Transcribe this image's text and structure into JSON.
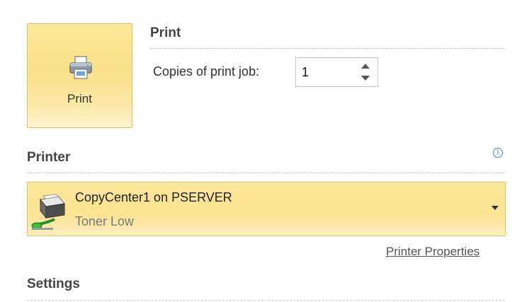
{
  "print_section": {
    "heading": "Print",
    "print_button_label": "Print",
    "copies_label": "Copies of print job:",
    "copies_value": "1"
  },
  "printer_section": {
    "heading": "Printer",
    "info_icon": "info-icon",
    "selected_printer": {
      "name": "CopyCenter1 on PSERVER",
      "status": "Toner Low"
    },
    "properties_link": "Printer Properties"
  },
  "settings_section": {
    "heading": "Settings"
  },
  "colors": {
    "accent_highlight": "#fbe08a",
    "accent_border": "#e3c063",
    "info_blue": "#4a8fd4"
  }
}
